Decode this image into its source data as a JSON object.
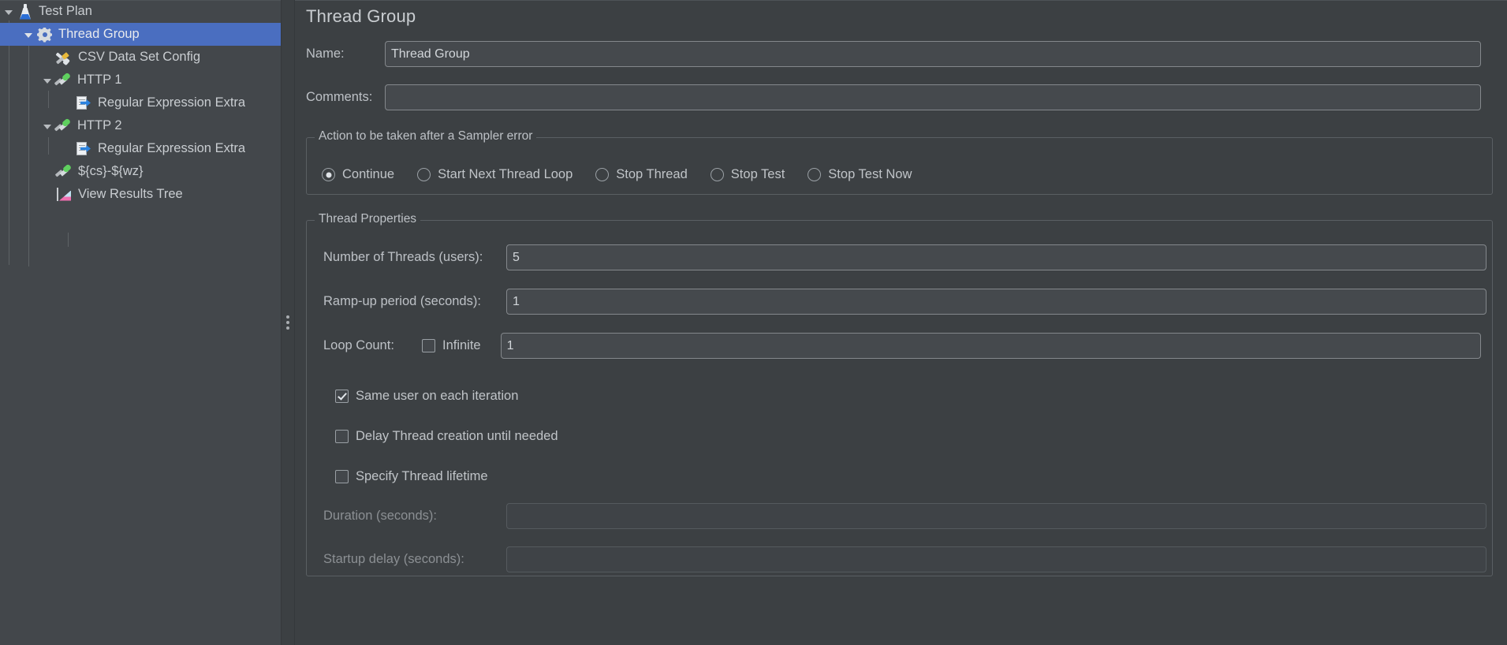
{
  "tree": {
    "name": "test-plan-tree",
    "items": [
      {
        "label": "Test Plan",
        "icon": "flask-icon",
        "indent": 0,
        "twisty": "open",
        "selected": false
      },
      {
        "label": "Thread Group",
        "icon": "gear-icon",
        "indent": 1,
        "twisty": "open",
        "selected": true
      },
      {
        "label": "CSV Data Set Config",
        "icon": "tools-icon",
        "indent": 2,
        "twisty": "none",
        "selected": false
      },
      {
        "label": "HTTP 1",
        "icon": "pipette-icon",
        "indent": 2,
        "twisty": "open",
        "selected": false
      },
      {
        "label": "Regular Expression Extra",
        "icon": "regex-icon",
        "indent": 3,
        "twisty": "none",
        "selected": false
      },
      {
        "label": "HTTP 2",
        "icon": "pipette-icon",
        "indent": 2,
        "twisty": "open",
        "selected": false
      },
      {
        "label": "Regular Expression Extra",
        "icon": "regex-icon",
        "indent": 3,
        "twisty": "none",
        "selected": false
      },
      {
        "label": "${cs}-${wz}",
        "icon": "pipette-icon",
        "indent": 2,
        "twisty": "none",
        "selected": false
      },
      {
        "label": "View Results Tree",
        "icon": "results-icon",
        "indent": 2,
        "twisty": "none",
        "selected": false
      }
    ]
  },
  "panel": {
    "title": "Thread Group",
    "name_label": "Name:",
    "name_value": "Thread Group",
    "name_placeholder": "",
    "comments_label": "Comments:",
    "comments_value": "",
    "comments_placeholder": ""
  },
  "sampler_error": {
    "legend": "Action to be taken after a Sampler error",
    "selected": "Continue",
    "options": [
      {
        "label": "Continue",
        "checked": true
      },
      {
        "label": "Start Next Thread Loop",
        "checked": false
      },
      {
        "label": "Stop Thread",
        "checked": false
      },
      {
        "label": "Stop Test",
        "checked": false
      },
      {
        "label": "Stop Test Now",
        "checked": false
      }
    ]
  },
  "thread_properties": {
    "legend": "Thread Properties",
    "num_threads_label": "Number of Threads (users):",
    "num_threads_value": "5",
    "ramp_up_label": "Ramp-up period (seconds):",
    "ramp_up_value": "1",
    "loop_count_label": "Loop Count:",
    "loop_infinite_label": "Infinite",
    "loop_infinite_checked": false,
    "loop_count_value": "1",
    "same_user_label": "Same user on each iteration",
    "same_user_checked": true,
    "delay_thread_label": "Delay Thread creation until needed",
    "delay_thread_checked": false,
    "specify_lifetime_label": "Specify Thread lifetime",
    "specify_lifetime_checked": false,
    "duration_label": "Duration (seconds):",
    "duration_value": "",
    "duration_enabled": false,
    "startup_delay_label": "Startup delay (seconds):",
    "startup_delay_value": "",
    "startup_delay_enabled": false
  },
  "splitter": {
    "name": "panel-splitter",
    "grip_dots": 3
  },
  "colors": {
    "background": "#3c4043",
    "tree_background": "#43474b",
    "selection": "#4a6ec0",
    "text": "#c0c4c8",
    "disabled_text": "#8b8f93",
    "field_background": "#45494d",
    "field_border": "#84888c",
    "group_border": "#5a5f63"
  }
}
